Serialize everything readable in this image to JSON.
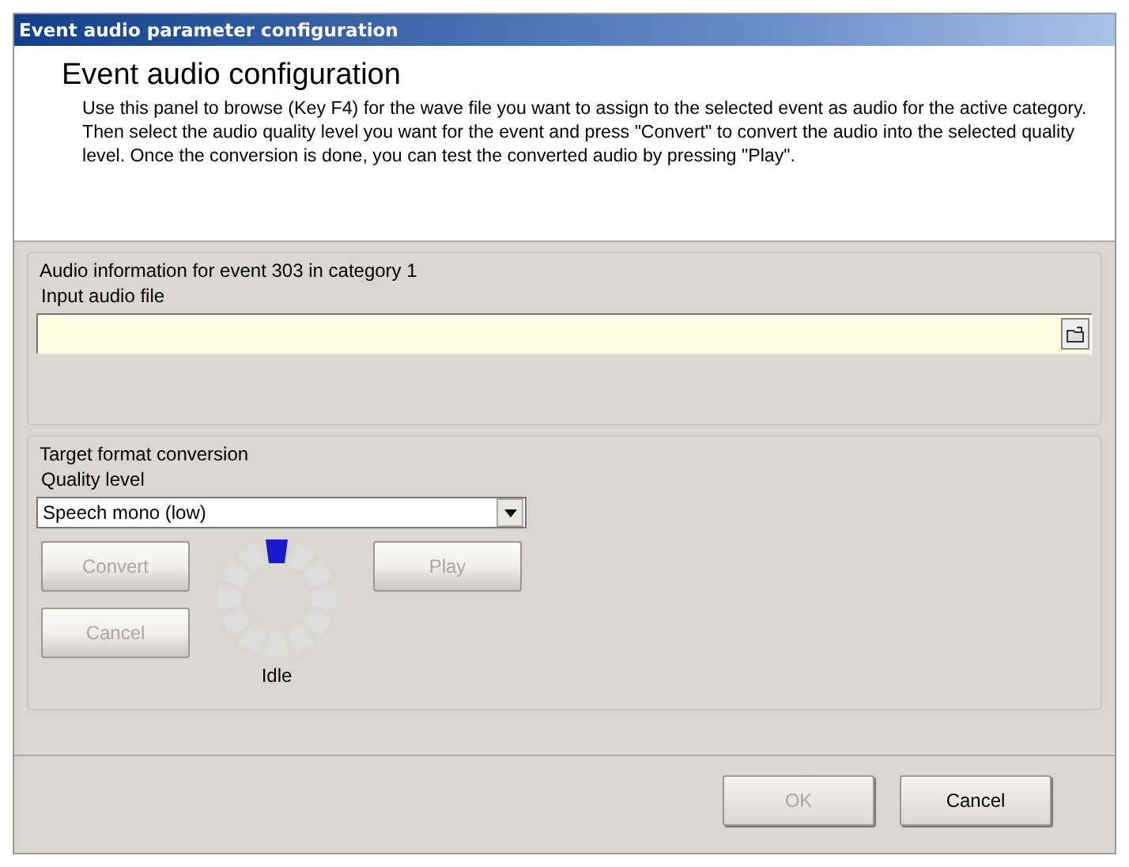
{
  "window": {
    "title": "Event audio parameter configuration"
  },
  "header": {
    "title": "Event audio configuration",
    "description": "Use this panel to browse (Key F4) for the wave file you want to assign to the selected event as audio for the active category. Then select the audio quality level you want for the event and press \"Convert\" to convert the audio into the selected quality level. Once the conversion is done, you can test the converted audio by pressing \"Play\"."
  },
  "audio_info": {
    "title": "Audio information for event 303 in category 1",
    "input_label": "Input audio file"
  },
  "conversion": {
    "title": "Target format conversion",
    "quality_label": "Quality level",
    "quality_value": "Speech mono (low)",
    "buttons": [
      {
        "label": "Convert",
        "disabled": true,
        "kind": "left"
      },
      {
        "label": "Cancel",
        "disabled": true,
        "kind": "left"
      },
      {
        "label": "Play",
        "disabled": true,
        "kind": "right"
      }
    ],
    "status": "Idle"
  },
  "footer_buttons": [
    {
      "label": "OK",
      "disabled": true
    },
    {
      "label": "Cancel",
      "disabled": false
    }
  ]
}
